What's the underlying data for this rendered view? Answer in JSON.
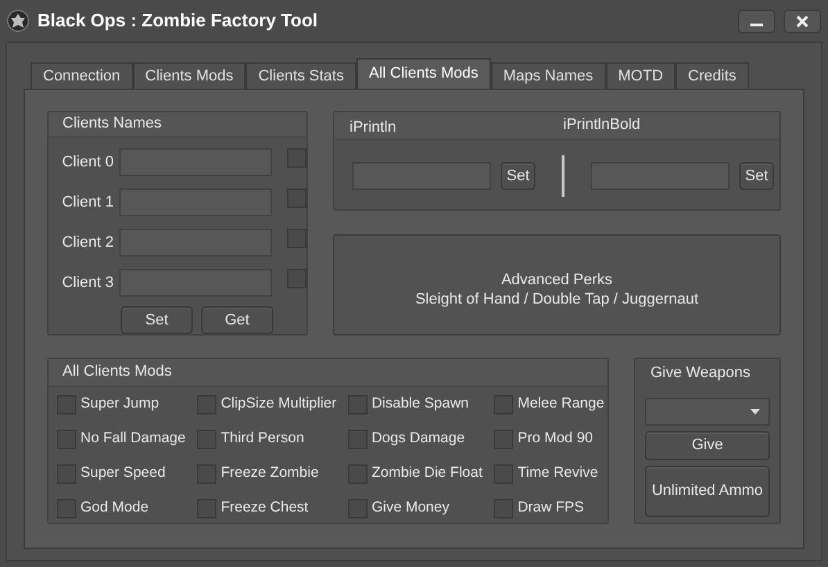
{
  "window": {
    "title": "Black Ops : Zombie Factory Tool"
  },
  "tabs": [
    {
      "label": "Connection",
      "selected": false
    },
    {
      "label": "Clients Mods",
      "selected": false
    },
    {
      "label": "Clients Stats",
      "selected": false
    },
    {
      "label": "All Clients Mods",
      "selected": true
    },
    {
      "label": "Maps Names",
      "selected": false
    },
    {
      "label": "MOTD",
      "selected": false
    },
    {
      "label": "Credits",
      "selected": false
    }
  ],
  "clients_names": {
    "title": "Clients Names",
    "clients": [
      {
        "label": "Client 0",
        "checked": false
      },
      {
        "label": "Client 1",
        "checked": false
      },
      {
        "label": "Client 2",
        "checked": false
      },
      {
        "label": "Client 3",
        "checked": false
      }
    ],
    "buttons": [
      "Set",
      "Get"
    ]
  },
  "print": {
    "sections": [
      {
        "title": "iPrintln",
        "button": "Set"
      },
      {
        "title": "iPrintlnBold",
        "button": "Set"
      }
    ]
  },
  "advanced_perks": {
    "lines": [
      "Advanced Perks",
      "Sleight of Hand / Double Tap / Juggernaut"
    ]
  },
  "all_clients_mods": {
    "title": "All Clients Mods",
    "mods": [
      {
        "label": "Super Jump",
        "checked": false
      },
      {
        "label": "ClipSize Multiplier",
        "checked": false
      },
      {
        "label": "Disable Spawn",
        "checked": false
      },
      {
        "label": "Melee Range",
        "checked": false
      },
      {
        "label": "No Fall Damage",
        "checked": false
      },
      {
        "label": "Third Person",
        "checked": false
      },
      {
        "label": "Dogs Damage",
        "checked": false
      },
      {
        "label": "Pro Mod 90",
        "checked": false
      },
      {
        "label": "Super Speed",
        "checked": false
      },
      {
        "label": "Freeze Zombie",
        "checked": false
      },
      {
        "label": "Zombie Die Float",
        "checked": false
      },
      {
        "label": "Time Revive",
        "checked": false
      },
      {
        "label": "God Mode",
        "checked": false
      },
      {
        "label": "Freeze Chest",
        "checked": false
      },
      {
        "label": "Give Money",
        "checked": false
      },
      {
        "label": "Draw FPS",
        "checked": false
      }
    ]
  },
  "give_weapons": {
    "title": "Give Weapons",
    "buttons": [
      "Give",
      "Unlimited Ammo"
    ]
  }
}
